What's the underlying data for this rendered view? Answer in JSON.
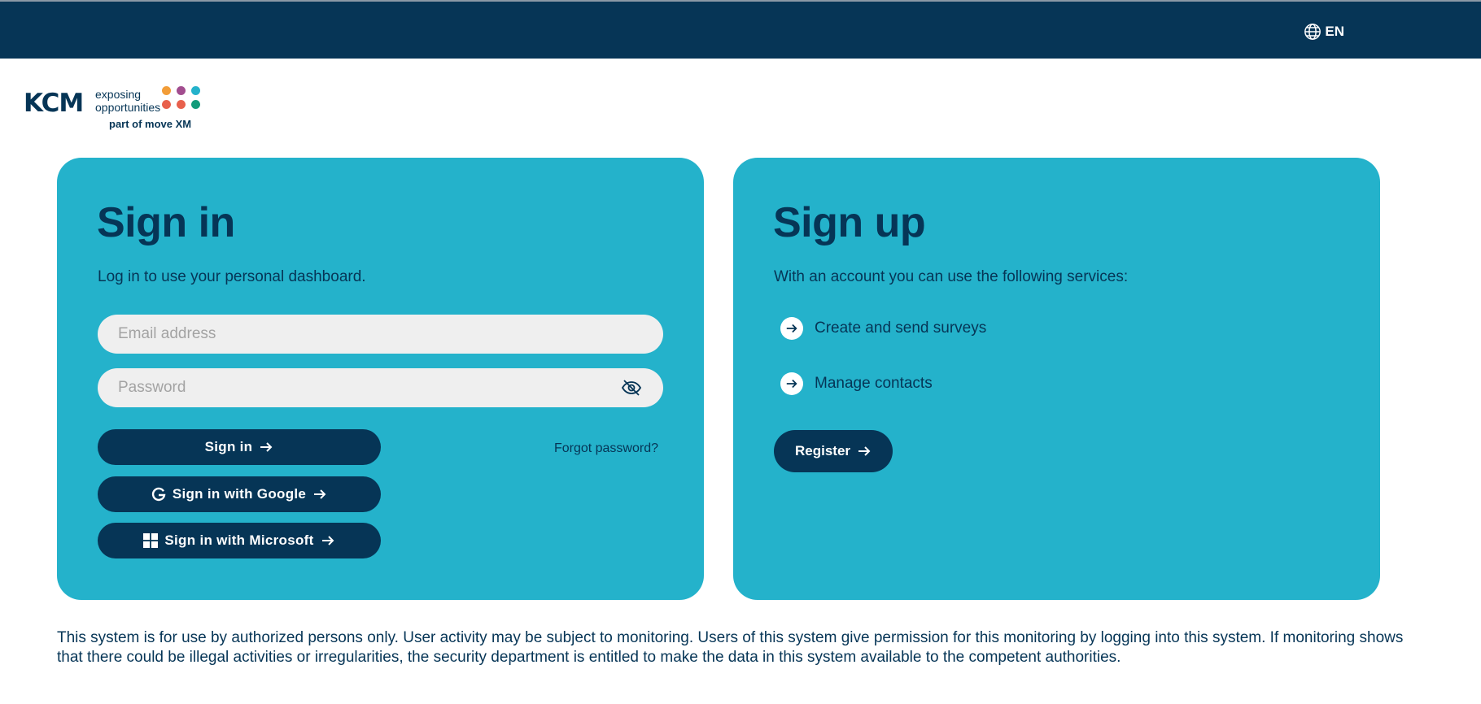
{
  "header": {
    "language": "EN"
  },
  "logo": {
    "brand": "KCM",
    "tagline_line1": "exposing",
    "tagline_line2": "opportunities",
    "sub": "part of move XM",
    "dot_colors": [
      "#f29d38",
      "#a24d8f",
      "#24b2cb",
      "#e8604c",
      "#e8604c",
      "#139b7a"
    ]
  },
  "signin": {
    "title": "Sign in",
    "subtitle": "Log in to use your personal dashboard.",
    "email_placeholder": "Email address",
    "password_placeholder": "Password",
    "signin_label": "Sign in",
    "google_label": "Sign in with Google",
    "microsoft_label": "Sign in with Microsoft",
    "forgot_label": "Forgot password?"
  },
  "signup": {
    "title": "Sign up",
    "subtitle": "With an account you can use the following services:",
    "services": [
      "Create and send surveys",
      "Manage contacts"
    ],
    "register_label": "Register"
  },
  "disclaimer": "This system is for use by authorized persons only. User activity may be subject to monitoring. Users of this system give permission for this monitoring by logging into this system. If monitoring shows that there could be illegal activities or irregularities, the security department is entitled to make the data in this system available to the competent authorities.",
  "colors": {
    "navy": "#063556",
    "teal": "#24b2cb",
    "field": "#efefef"
  }
}
